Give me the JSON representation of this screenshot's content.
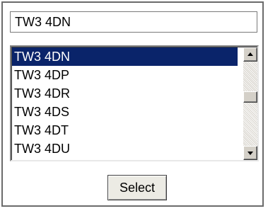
{
  "input": {
    "value": "TW3 4DN"
  },
  "listbox": {
    "options": [
      "TW3 4DN",
      "TW3 4DP",
      "TW3 4DR",
      "TW3 4DS",
      "TW3 4DT",
      "TW3 4DU"
    ],
    "selected_index": 0
  },
  "button": {
    "label": "Select"
  },
  "colors": {
    "selection_bg": "#0a246a",
    "selection_fg": "#ffffff",
    "frame_border": "#6b6b6b",
    "button_face": "#ecebe4"
  },
  "icons": {
    "scroll_up": "triangle-up",
    "scroll_down": "triangle-down"
  }
}
